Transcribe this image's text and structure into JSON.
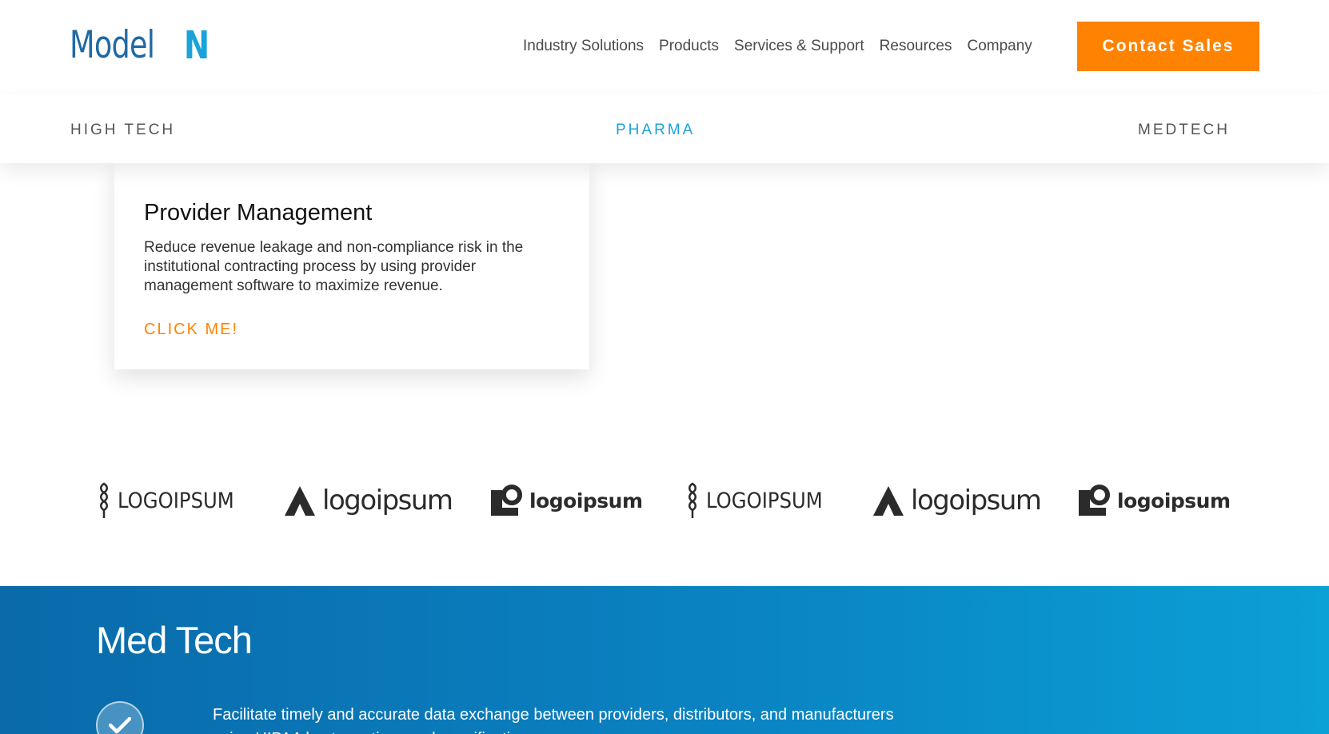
{
  "header": {
    "logo": {
      "text_primary": "Model",
      "text_accent": "N"
    },
    "nav": [
      {
        "label": "Industry Solutions"
      },
      {
        "label": "Products"
      },
      {
        "label": "Services & Support"
      },
      {
        "label": "Resources"
      },
      {
        "label": "Company"
      }
    ],
    "cta_label": "Contact Sales",
    "cta_color": "#ff8300"
  },
  "tabs": [
    {
      "label": "HIGH TECH",
      "active": false
    },
    {
      "label": "PHARMA",
      "active": true
    },
    {
      "label": "MEDTECH",
      "active": false
    }
  ],
  "card": {
    "title": "Provider Management",
    "description": "Reduce revenue leakage and non-compliance risk in the institutional contracting process by using provider management software to maximize revenue.",
    "link_label": "CLICK ME!"
  },
  "logos": [
    {
      "icon": "wheat-icon",
      "text": "LOGOIPSUM"
    },
    {
      "icon": "mountain-icon",
      "text": "logoipsum"
    },
    {
      "icon": "square-circle-icon",
      "text": "logoipsum"
    },
    {
      "icon": "wheat-icon",
      "text": "LOGOIPSUM"
    },
    {
      "icon": "mountain-icon",
      "text": "logoipsum"
    },
    {
      "icon": "square-circle-icon",
      "text": "logoipsum"
    }
  ],
  "medtech": {
    "title": "Med Tech",
    "check_icon": "check-icon",
    "text": "Facilitate timely and accurate data exchange between providers, distributors, and manufacturers using HIPAA best practices and specifications."
  },
  "colors": {
    "brand_blue": "#1f6aa5",
    "accent_blue": "#1aa3d9",
    "orange": "#ff8300"
  }
}
